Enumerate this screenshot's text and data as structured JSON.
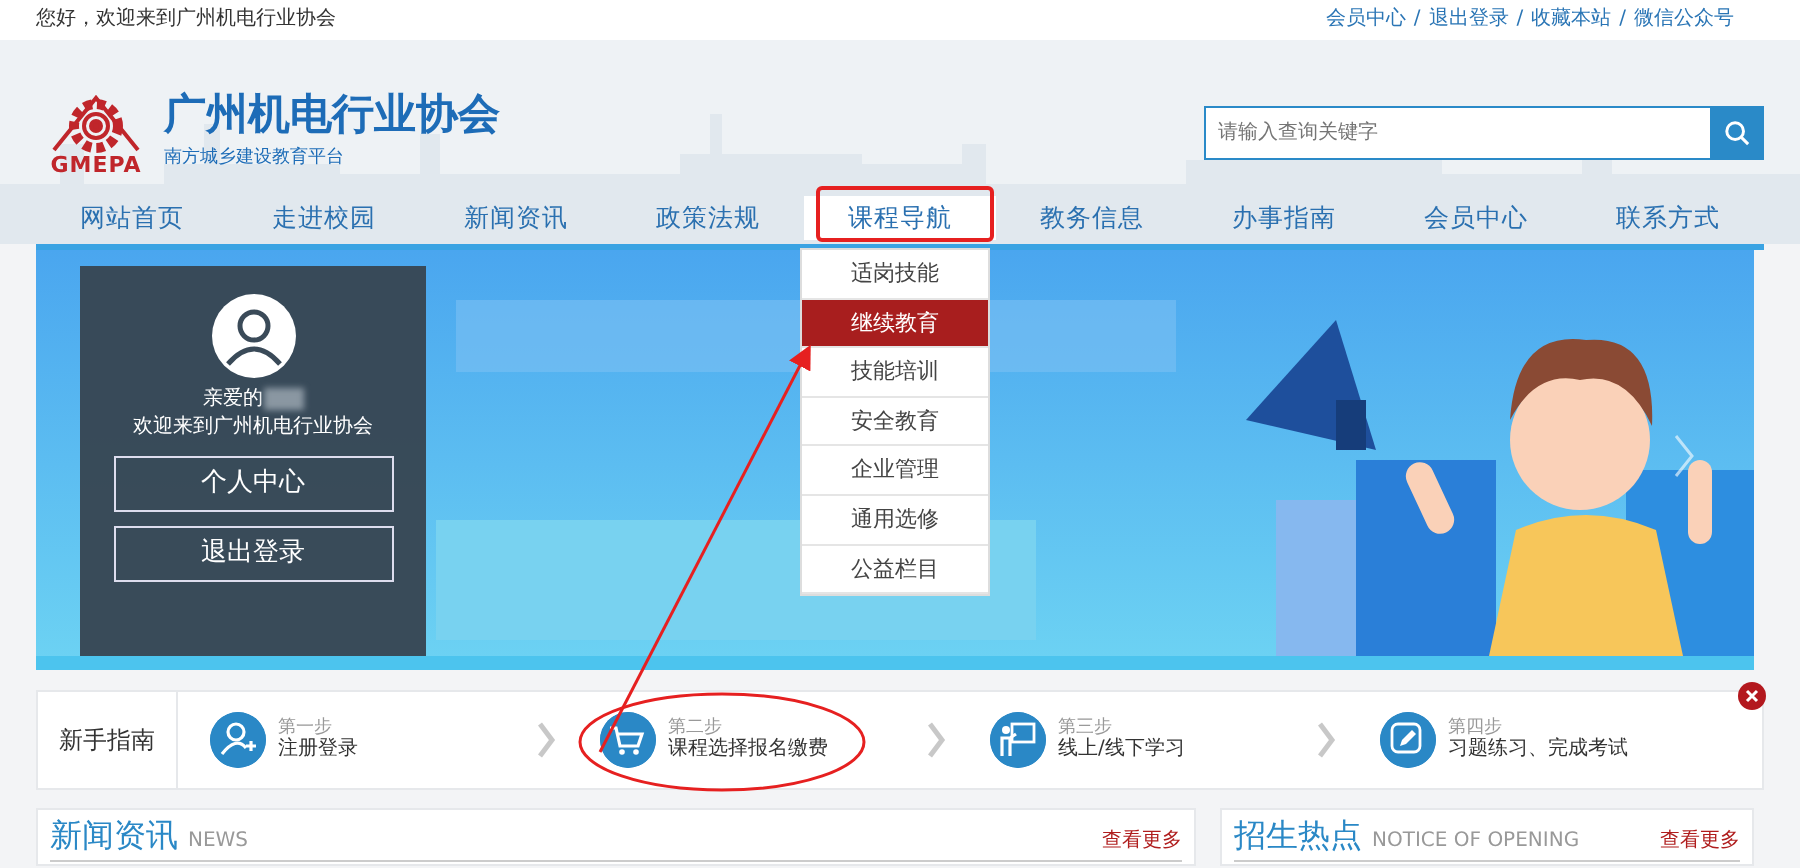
{
  "top_bar": {
    "greeting": "您好，欢迎来到广州机电行业协会",
    "links": [
      "会员中心",
      "退出登录",
      "收藏本站",
      "微信公众号"
    ],
    "separator": "/"
  },
  "header": {
    "logo_text": "GMEPA",
    "title": "广州机电行业协会",
    "subtitle": "南方城乡建设教育平台",
    "search": {
      "placeholder": "请输入查询关键字"
    }
  },
  "nav": [
    {
      "label": "网站首页",
      "selected": false
    },
    {
      "label": "走进校园",
      "selected": false
    },
    {
      "label": "新闻资讯",
      "selected": false
    },
    {
      "label": "政策法规",
      "selected": false
    },
    {
      "label": "课程导航",
      "selected": true
    },
    {
      "label": "教务信息",
      "selected": false
    },
    {
      "label": "办事指南",
      "selected": false
    },
    {
      "label": "会员中心",
      "selected": false
    },
    {
      "label": "联系方式",
      "selected": false
    }
  ],
  "dropdown": [
    {
      "label": "适岗技能",
      "selected": false
    },
    {
      "label": "继续教育",
      "selected": true
    },
    {
      "label": "技能培训",
      "selected": false
    },
    {
      "label": "安全教育",
      "selected": false
    },
    {
      "label": "企业管理",
      "selected": false
    },
    {
      "label": "通用选修",
      "selected": false
    },
    {
      "label": "公益栏目",
      "selected": false
    }
  ],
  "login_panel": {
    "greeting": "亲爱的",
    "welcome": "欢迎来到广州机电行业协会",
    "buttons": [
      "个人中心",
      "退出登录"
    ]
  },
  "guide": {
    "title": "新手指南",
    "steps": [
      {
        "kind": "user",
        "step": "第一步",
        "label": "注册登录"
      },
      {
        "kind": "cart",
        "step": "第二步",
        "label": "课程选择报名缴费"
      },
      {
        "kind": "study",
        "step": "第三步",
        "label": "线上/线下学习"
      },
      {
        "kind": "exam",
        "step": "第四步",
        "label": "习题练习、完成考试"
      }
    ]
  },
  "sections": [
    {
      "title": "新闻资讯",
      "subtitle": "NEWS",
      "more": "查看更多"
    },
    {
      "title": "招生热点",
      "subtitle": "NOTICE OF OPENING",
      "more": "查看更多"
    }
  ]
}
